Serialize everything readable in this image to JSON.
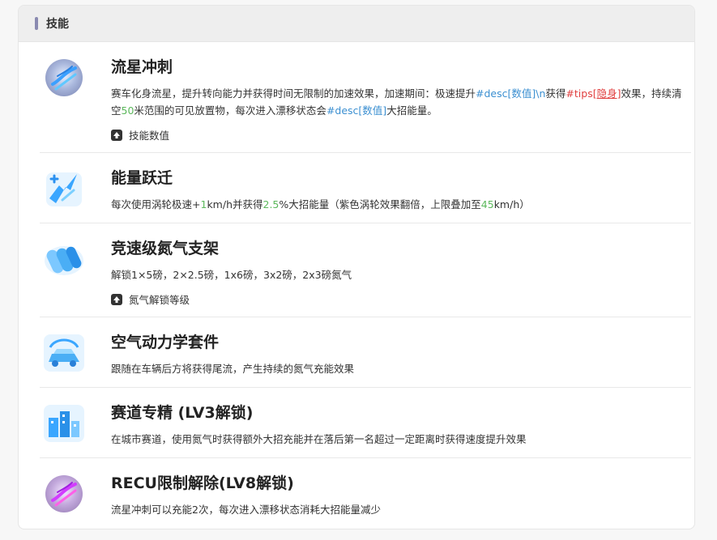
{
  "panel": {
    "title": "技能"
  },
  "skills": [
    {
      "icon": "meteor-icon",
      "name": "流星冲刺",
      "desc": {
        "p1": "赛车化身流星，提升转向能力并获得时间无限制的加速效果，加速期间：极速提升",
        "p2": "#desc[数值]\\n",
        "p3": "获得",
        "p4": "#tips[",
        "p5": "隐身",
        "p6": "]",
        "p7": "效果，持续清空",
        "p8": "50",
        "p9": "米范围的可见放置物，每次进入漂移状态会",
        "p10": "#desc[数值]",
        "p11": "大招能量。"
      },
      "action": "技能数值"
    },
    {
      "icon": "energy-leap-icon",
      "name": "能量跃迁",
      "desc": {
        "p1": "每次使用涡轮极速+",
        "p2": "1",
        "p3": "km/h并获得",
        "p4": "2.5",
        "p5": "%大招能量（紫色涡轮效果翻倍，上限叠加至",
        "p6": "45",
        "p7": "km/h）"
      }
    },
    {
      "icon": "nitro-rack-icon",
      "name": "竞速级氮气支架",
      "desc": {
        "text": "解锁1×5磅，2×2.5磅，1x6磅，3x2磅，2x3磅氮气"
      },
      "action": "氮气解锁等级"
    },
    {
      "icon": "aero-kit-icon",
      "name": "空气动力学套件",
      "desc": {
        "text": "跟随在车辆后方将获得尾流，产生持续的氮气充能效果"
      }
    },
    {
      "icon": "city-track-icon",
      "name": "赛道专精 (LV3解锁)",
      "desc": {
        "text": "在城市赛道，使用氮气时获得额外大招充能并在落后第一名超过一定距离时获得速度提升效果"
      }
    },
    {
      "icon": "recu-icon",
      "name": "RECU限制解除(LV8解锁)",
      "desc": {
        "text": "流星冲刺可以充能2次，每次进入漂移状态消耗大招能量减少"
      }
    }
  ]
}
